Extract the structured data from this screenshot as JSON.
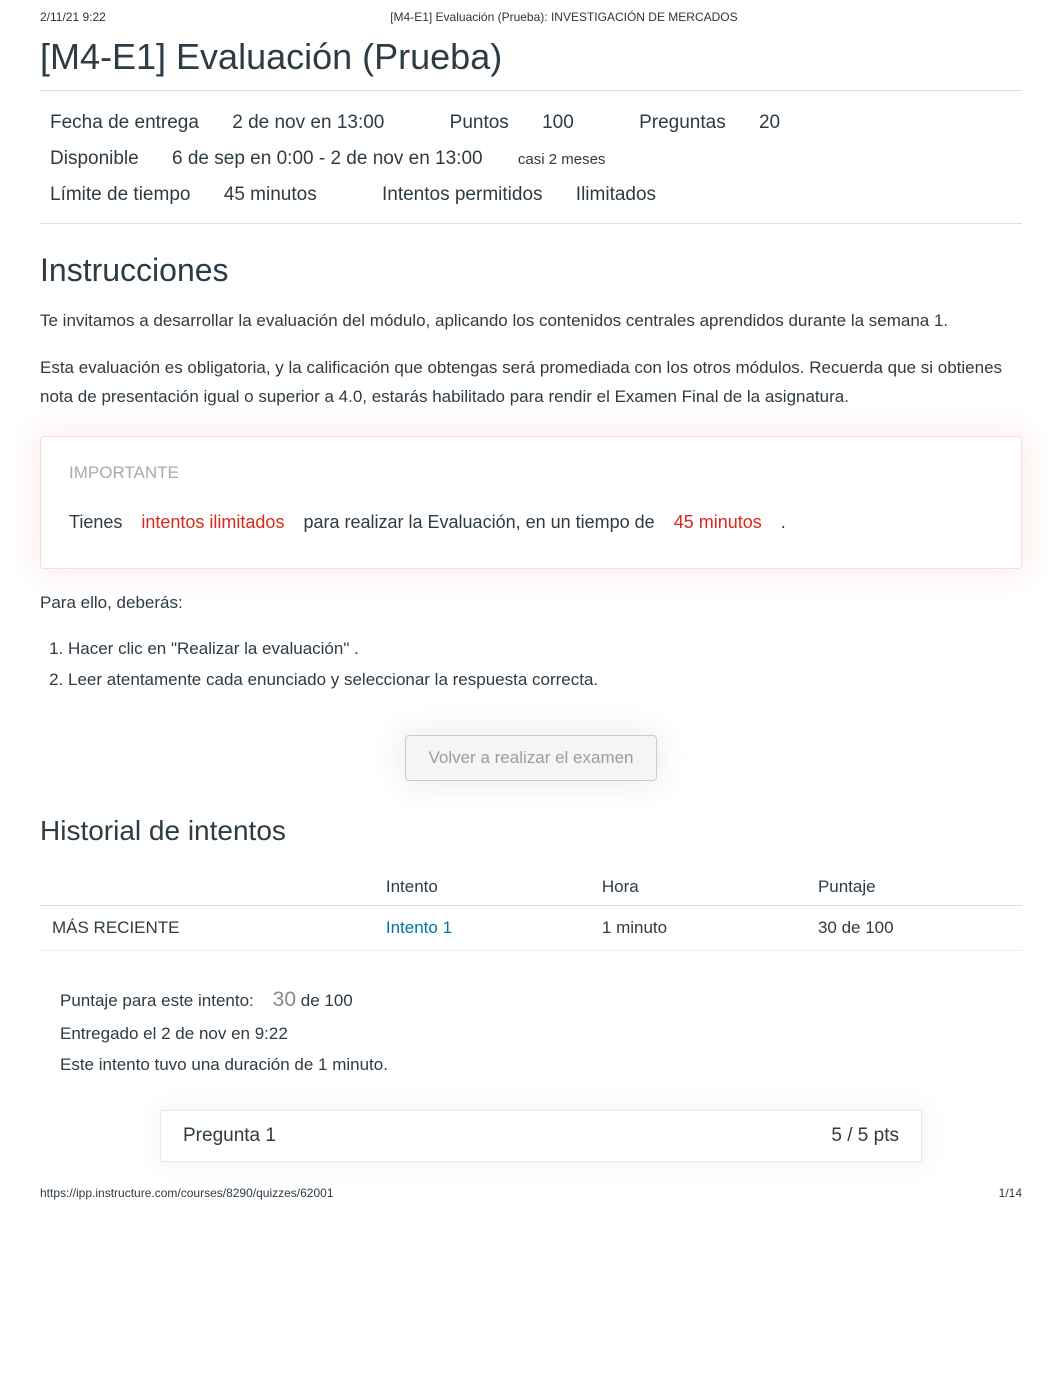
{
  "header": {
    "datetime": "2/11/21 9:22",
    "doc_title": "[M4-E1] Evaluación (Prueba): INVESTIGACIÓN DE MERCADOS"
  },
  "quiz": {
    "title": "[M4-E1] Evaluación (Prueba)",
    "meta": {
      "due_label": "Fecha de entrega",
      "due_value": "2 de nov en 13:00",
      "points_label": "Puntos",
      "points_value": "100",
      "questions_label": "Preguntas",
      "questions_value": "20",
      "available_label": "Disponible",
      "available_value": "6 de sep en 0:00 - 2 de nov en 13:00",
      "available_note": "casi 2 meses",
      "timelimit_label": "Límite de tiempo",
      "timelimit_value": "45 minutos",
      "attempts_label": "Intentos permitidos",
      "attempts_value": "Ilimitados"
    }
  },
  "instructions": {
    "heading": "Instrucciones",
    "p1": "Te invitamos a desarrollar la evaluación del módulo, aplicando los contenidos centrales aprendidos durante la semana 1.",
    "p2": "Esta evaluación es obligatoria, y la calificación que obtengas será promediada con los otros módulos. Recuerda que si obtienes nota de presentación igual o superior a 4.0, estarás habilitado para rendir el Examen Final de la asignatura.",
    "imp_title": "IMPORTANTE",
    "imp_t1": "Tienes",
    "imp_red1": "intentos ilimitados",
    "imp_t2": "para realizar la Evaluación, en un tiempo de",
    "imp_red2": "45 minutos",
    "imp_t3": ".",
    "para": "Para ello, deberás:",
    "step1_a": "Hacer clic en ",
    "step1_b": "\"Realizar la evaluación\"",
    "step1_c": ".",
    "step2": "Leer atentamente cada enunciado y seleccionar la respuesta correcta."
  },
  "retake_button": "Volver a realizar el examen",
  "history": {
    "heading": "Historial de intentos",
    "cols": {
      "blank": "",
      "attempt": "Intento",
      "time": "Hora",
      "score": "Puntaje"
    },
    "rows": [
      {
        "recent": "MÁS RECIENTE",
        "attempt_link": "Intento 1",
        "time": "1 minuto",
        "score": "30 de 100"
      }
    ]
  },
  "attempt_summary": {
    "line1_label": "Puntaje para este intento:",
    "line1_score": "30",
    "line1_rest": " de 100",
    "line2": "Entregado el 2 de nov en 9:22",
    "line3": "Este intento tuvo una duración de 1 minuto."
  },
  "question1": {
    "title": "Pregunta 1",
    "pts": "5 / 5 pts"
  },
  "footer": {
    "url": "https://ipp.instructure.com/courses/8290/quizzes/62001",
    "page": "1/14"
  }
}
